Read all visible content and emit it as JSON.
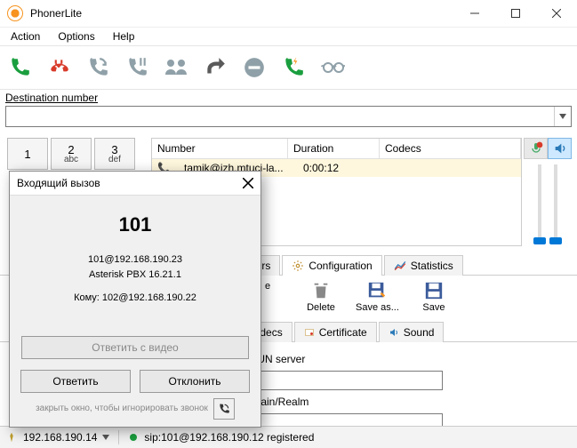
{
  "window": {
    "title": "PhonerLite"
  },
  "menu": {
    "action": "Action",
    "options": "Options",
    "help": "Help"
  },
  "destination": {
    "label": "Destination number",
    "value": ""
  },
  "dialpad": [
    {
      "d": "1",
      "l": ""
    },
    {
      "d": "2",
      "l": "abc"
    },
    {
      "d": "3",
      "l": "def"
    }
  ],
  "calls": {
    "headers": {
      "number": "Number",
      "duration": "Duration",
      "codecs": "Codecs"
    },
    "row": {
      "number": "tamik@izh.mtuci-la...",
      "duration": "0:00:12",
      "codecs": ""
    }
  },
  "tabs": {
    "ours": "ours",
    "configuration": "Configuration",
    "statistics": "Statistics"
  },
  "cfg_toolbar": {
    "e": "e",
    "delete": "Delete",
    "saveas": "Save as...",
    "save": "Save"
  },
  "subtabs": {
    "codecs": "Codecs",
    "certificate": "Certificate",
    "sound": "Sound"
  },
  "fields": {
    "stun": "STUN server",
    "stun_value": "",
    "domain": "Domain/Realm",
    "domain_value": ""
  },
  "status": {
    "local_ip": "192.168.190.14",
    "reg": "sip:101@192.168.190.12 registered"
  },
  "incoming": {
    "title": "Входящий вызов",
    "caller": "101",
    "line1": "101@192.168.190.23",
    "line2": "Asterisk PBX 16.21.1",
    "to_label": "Кому: 102@192.168.190.22",
    "btn_video": "Ответить с видео",
    "btn_answer": "Ответить",
    "btn_decline": "Отклонить",
    "hint": "закрыть окно, чтобы игнорировать звонок"
  }
}
